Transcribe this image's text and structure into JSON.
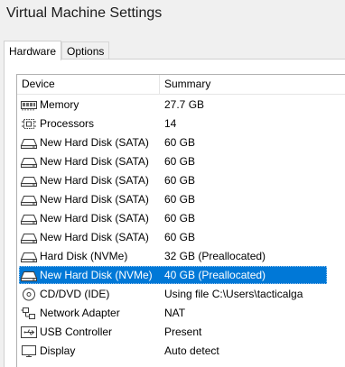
{
  "window": {
    "title": "Virtual Machine Settings"
  },
  "tabs": [
    {
      "label": "Hardware",
      "active": true
    },
    {
      "label": "Options",
      "active": false
    }
  ],
  "device_list": {
    "columns": {
      "device": "Device",
      "summary": "Summary"
    },
    "rows": [
      {
        "icon": "memory-icon",
        "name": "Memory",
        "summary": "27.7 GB",
        "selected": false
      },
      {
        "icon": "processor-icon",
        "name": "Processors",
        "summary": "14",
        "selected": false
      },
      {
        "icon": "hard-disk-icon",
        "name": "New Hard Disk (SATA)",
        "summary": "60 GB",
        "selected": false
      },
      {
        "icon": "hard-disk-icon",
        "name": "New Hard Disk (SATA)",
        "summary": "60 GB",
        "selected": false
      },
      {
        "icon": "hard-disk-icon",
        "name": "New Hard Disk (SATA)",
        "summary": "60 GB",
        "selected": false
      },
      {
        "icon": "hard-disk-icon",
        "name": "New Hard Disk (SATA)",
        "summary": "60 GB",
        "selected": false
      },
      {
        "icon": "hard-disk-icon",
        "name": "New Hard Disk (SATA)",
        "summary": "60 GB",
        "selected": false
      },
      {
        "icon": "hard-disk-icon",
        "name": "New Hard Disk (SATA)",
        "summary": "60 GB",
        "selected": false
      },
      {
        "icon": "hard-disk-icon",
        "name": "Hard Disk (NVMe)",
        "summary": "32 GB (Preallocated)",
        "selected": false
      },
      {
        "icon": "hard-disk-icon",
        "name": "New Hard Disk (NVMe)",
        "summary": "40 GB (Preallocated)",
        "selected": true
      },
      {
        "icon": "cd-dvd-icon",
        "name": "CD/DVD (IDE)",
        "summary": "Using file C:\\Users\\tacticalga",
        "selected": false
      },
      {
        "icon": "network-adapter-icon",
        "name": "Network Adapter",
        "summary": "NAT",
        "selected": false
      },
      {
        "icon": "usb-icon",
        "name": "USB Controller",
        "summary": "Present",
        "selected": false
      },
      {
        "icon": "display-icon",
        "name": "Display",
        "summary": "Auto detect",
        "selected": false
      }
    ]
  }
}
